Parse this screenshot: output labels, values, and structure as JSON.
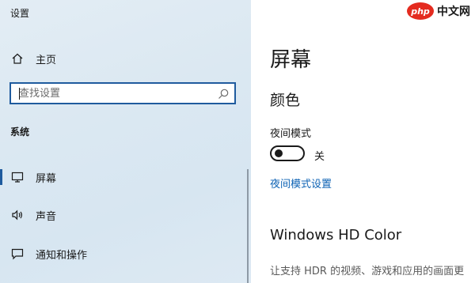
{
  "window": {
    "title": "设置"
  },
  "sidebar": {
    "home_label": "主页",
    "search": {
      "placeholder": "查找设置"
    },
    "section_title": "系统",
    "items": [
      {
        "label": "屏幕",
        "icon": "monitor-icon",
        "active": true
      },
      {
        "label": "声音",
        "icon": "speaker-icon",
        "active": false
      },
      {
        "label": "通知和操作",
        "icon": "notification-icon",
        "active": false
      }
    ]
  },
  "main": {
    "page_title": "屏幕",
    "color_section": "颜色",
    "night_light": {
      "label": "夜间模式",
      "state": "关",
      "on": false
    },
    "night_light_settings_link": "夜间模式设置",
    "hd_color": {
      "title": "Windows HD Color",
      "description": "让支持 HDR 的视频、游戏和应用的画面更"
    }
  },
  "watermark": {
    "badge": "php",
    "text": "中文网"
  },
  "colors": {
    "accent": "#1f5b9e",
    "link": "#0c62b4",
    "brand_red": "#e42b1f"
  }
}
